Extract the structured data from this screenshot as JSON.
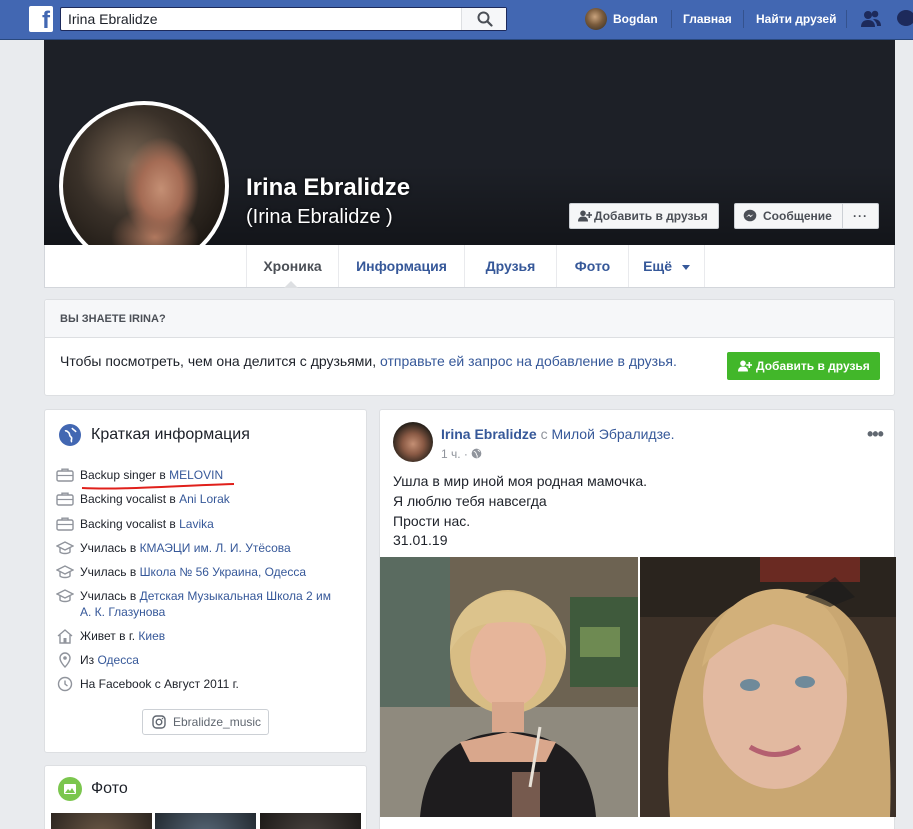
{
  "topbar": {
    "search_value": "Irina Ebralidze",
    "user_name": "Bogdan",
    "home_label": "Главная",
    "find_friends_label": "Найти друзей"
  },
  "profile": {
    "name": "Irina Ebralidze",
    "alternate_name": "(Irina Ebralidze )",
    "add_friend_label": "Добавить в друзья",
    "message_label": "Сообщение",
    "more_label": "···"
  },
  "tabs": [
    {
      "label": "Хроника",
      "active": true
    },
    {
      "label": "Информация"
    },
    {
      "label": "Друзья"
    },
    {
      "label": "Фото"
    },
    {
      "label": "Ещё"
    }
  ],
  "know_box": {
    "heading": "ВЫ ЗНАЕТЕ IRINA?",
    "text_before": "Чтобы посмотреть, чем она делится с друзьями, ",
    "text_link": "отправьте ей запрос на добавление в друзья.",
    "button_label": "Добавить в друзья"
  },
  "intro": {
    "title": "Краткая информация",
    "rows": [
      {
        "icon": "briefcase-icon",
        "prefix": "Backup singer в ",
        "link": "MELOVIN"
      },
      {
        "icon": "briefcase-icon",
        "prefix": "Backing vocalist в ",
        "link": "Ani Lorak"
      },
      {
        "icon": "briefcase-icon",
        "prefix": "Backing vocalist в ",
        "link": "Lavika"
      },
      {
        "icon": "graduation-cap-icon",
        "prefix": "Училась в ",
        "link": "КМАЭЦИ им. Л. И. Утёсова"
      },
      {
        "icon": "graduation-cap-icon",
        "prefix": "Училась в ",
        "link": "Школа № 56 Украина, Одесса"
      },
      {
        "icon": "graduation-cap-icon",
        "prefix": "Училась в ",
        "link": "Детская Музыкальная Школа 2 им А. К. Глазунова"
      },
      {
        "icon": "home-icon",
        "prefix": "Живет в г. ",
        "link": "Киев"
      },
      {
        "icon": "location-pin-icon",
        "prefix": "Из ",
        "link": "Одесса"
      },
      {
        "icon": "clock-icon",
        "prefix": "На Facebook с Август 2011 г.",
        "link": ""
      }
    ],
    "instagram_label": "Ebralidze_music"
  },
  "photo_card": {
    "title": "Фото"
  },
  "post": {
    "author": "Irina Ebralidze",
    "with_word": " с ",
    "tagged": "Милой Эбралидзе.",
    "time": "1 ч. · ",
    "lines": [
      "Ушла в мир иной моя родная мамочка.",
      "Я люблю тебя навсегда",
      "Прости нас.",
      "31.01.19"
    ],
    "menu_label": "•••"
  },
  "colors": {
    "brand": "#4267b2",
    "link": "#365899",
    "green": "#42b72a",
    "annotation_red": "#e0201b"
  }
}
